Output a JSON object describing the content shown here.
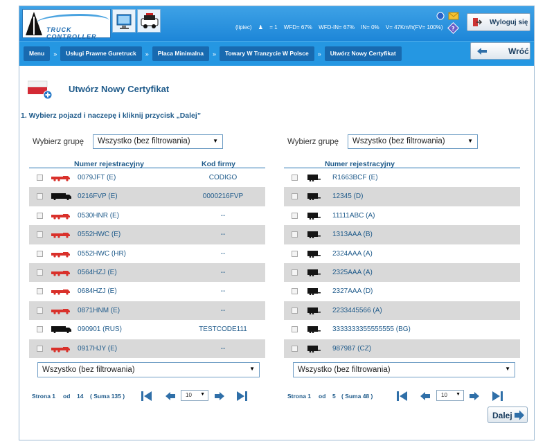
{
  "header": {
    "logo_text": "TRUCK CONTROLLER",
    "status": {
      "month": "(lipiec)",
      "driver_count": "= 1",
      "wfd": "WFD= 67%",
      "wfd_in": "WFD-IN= 67%",
      "in": "IN= 0%",
      "speed": "V= 47Km/h(FV= 100%)"
    },
    "logout_label": "Wyloguj się"
  },
  "breadcrumbs": [
    {
      "label": "Menu"
    },
    {
      "label": "Usługi Prawne Guretruck"
    },
    {
      "label": "Płaca Minimalna"
    },
    {
      "label": "Towary W Tranzycie W Polsce"
    },
    {
      "label": "Utwórz Nowy Certyfikat"
    }
  ],
  "back_label": "Wróć",
  "page_title": "Utwórz Nowy Certyfikat",
  "step_text": "1. Wybierz pojazd i naczepę i kliknij przycisk „Dalej”",
  "left": {
    "group_label": "Wybierz grupę",
    "group_value": "Wszystko (bez filtrowania)",
    "col_reg": "Numer rejestracyjny",
    "col_code": "Kod firmy",
    "rows": [
      {
        "reg": "0079JFT (E)",
        "code": "CODIGO",
        "type": "truck-red"
      },
      {
        "reg": "0216FVP (E)",
        "code": "0000216FVP",
        "type": "truck-black"
      },
      {
        "reg": "0530HNR (E)",
        "code": "--",
        "type": "truck-red"
      },
      {
        "reg": "0552HWC (E)",
        "code": "--",
        "type": "truck-red"
      },
      {
        "reg": "0552HWC (HR)",
        "code": "--",
        "type": "truck-red"
      },
      {
        "reg": "0564HZJ (E)",
        "code": "--",
        "type": "truck-red"
      },
      {
        "reg": "0684HZJ (E)",
        "code": "--",
        "type": "truck-red"
      },
      {
        "reg": "0871HNM (E)",
        "code": "--",
        "type": "truck-red"
      },
      {
        "reg": "090901 (RUS)",
        "code": "TESTCODE111",
        "type": "truck-black"
      },
      {
        "reg": "0917HJY (E)",
        "code": "--",
        "type": "truck-red"
      }
    ],
    "filter_value": "Wszystko (bez filtrowania)",
    "pager": {
      "page_text": "Strona 1",
      "of_text": "od",
      "total_pages": "14",
      "sum_text": "( Suma 135 )",
      "per_page": "10"
    }
  },
  "right": {
    "group_label": "Wybierz grupę",
    "group_value": "Wszystko (bez filtrowania)",
    "col_reg": "Numer rejestracyjny",
    "rows": [
      {
        "reg": "R1663BCF (E)"
      },
      {
        "reg": "12345 (D)"
      },
      {
        "reg": "11111ABC (A)"
      },
      {
        "reg": "1313AAA (B)"
      },
      {
        "reg": "2324AAA (A)"
      },
      {
        "reg": "2325AAA (A)"
      },
      {
        "reg": "2327AAA (D)"
      },
      {
        "reg": "2233445566 (A)"
      },
      {
        "reg": "3333333355555555 (BG)"
      },
      {
        "reg": "987987 (CZ)"
      }
    ],
    "filter_value": "Wszystko (bez filtrowania)",
    "pager": {
      "page_text": "Strona 1",
      "of_text": "od",
      "total_pages": "5",
      "sum_text": "( Suma 48 )",
      "per_page": "10"
    }
  },
  "next_label": "Dalej",
  "colors": {
    "header_blue": "#2597e2",
    "crumb_blue": "#186ab0",
    "title_blue": "#1e5a8a",
    "row_alt": "#d9d9d9",
    "truck_red": "#d9312b"
  }
}
